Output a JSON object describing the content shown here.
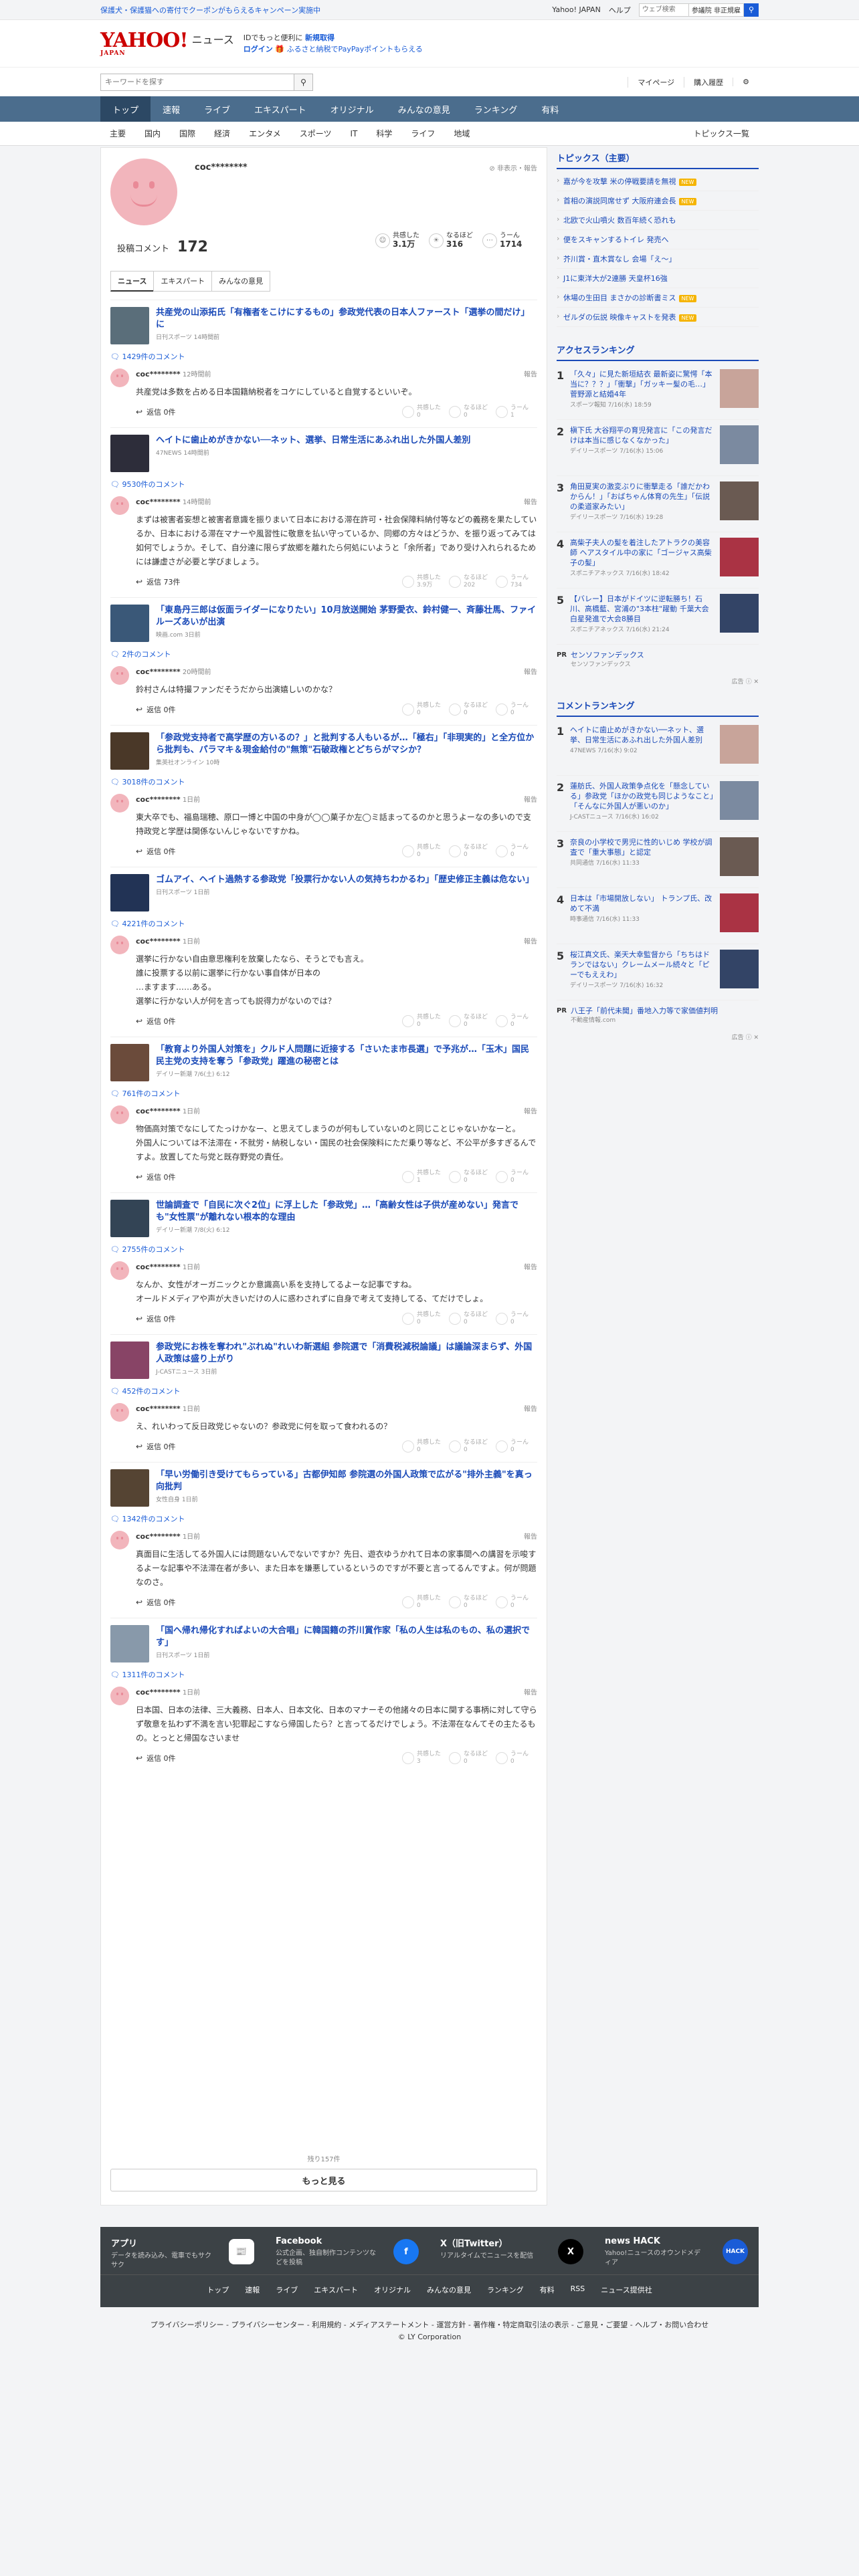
{
  "topbar": {
    "promo": "保護犬・保護猫への寄付でクーポンがもらえるキャンペーン実施中",
    "links": [
      "Yahoo! JAPAN",
      "ヘルプ"
    ],
    "search_placeholder": "ウェブ検索",
    "keyword": "参議院 非正規雇"
  },
  "header": {
    "logo": "YAHOO!",
    "logo_sub": "JAPAN",
    "section": "ニュース",
    "promo1_a": "IDでもっと便利に",
    "promo1_b": "新規取得",
    "promo2_a": "ログイン",
    "promo2_b": "ふるさと納税でPayPayポイントもらえる"
  },
  "search": {
    "placeholder": "キーワードを探す",
    "mypage": "マイページ",
    "history": "購入履歴"
  },
  "gnav": [
    "トップ",
    "速報",
    "ライブ",
    "エキスパート",
    "オリジナル",
    "みんなの意見",
    "ランキング",
    "有料"
  ],
  "subnav": [
    "主要",
    "国内",
    "国際",
    "経済",
    "エンタメ",
    "スポーツ",
    "IT",
    "科学",
    "ライフ",
    "地域"
  ],
  "subnav_right": "トピックス一覧",
  "profile": {
    "name": "coc********",
    "report": "非表示・報告",
    "stat_label": "投稿コメント",
    "stat_value": "172",
    "r1": "共感した",
    "r1v": "3.1万",
    "r2": "なるほど",
    "r2v": "316",
    "r3": "うーん",
    "r3v": "1714"
  },
  "tabs": [
    "ニュース",
    "エキスパート",
    "みんなの意見"
  ],
  "items": [
    {
      "title": "共産党の山添拓氏「有権者をこけにするもの」参政党代表の日本人ファースト「選挙の間だけ」に",
      "src": "日刊スポーツ 14時間前",
      "count": "1429件のコメント",
      "user": "coc********",
      "time": "12時間前",
      "report": "報告",
      "text": "共産党は多数を占める日本国籍納税者をコケにしていると自覚するといいぞ。",
      "reply": "返信 0件",
      "a": "共感した\n0",
      "b": "なるほど\n0",
      "c": "うーん\n1"
    },
    {
      "title": "ヘイトに歯止めがきかない──ネット、選挙、日常生活にあふれ出した外国人差別",
      "src": "47NEWS 14時間前",
      "count": "9530件のコメント",
      "user": "coc********",
      "time": "14時間前",
      "report": "報告",
      "text": "まずは被害者妄想と被害者意識を振りまいて日本における滞在許可・社会保障料納付等などの義務を果たしているか、日本における滞在マナーや風習性に敬意を払い守っているか、同郷の方々はどうか、を振り返ってみては如何でしょうか。そして、自分達に限らず故郷を離れたら何処にいようと「余所者」であり受け入れられるためには謙虚さが必要と学びましょう。",
      "reply": "返信 73件",
      "a": "共感した\n3.9万",
      "b": "なるほど\n202",
      "c": "うーん\n734"
    },
    {
      "title": "「東島丹三郎は仮面ライダーになりたい」10月放送開始 茅野愛衣、鈴村健一、斉藤壮馬、ファイルーズあいが出演",
      "src": "映画.com 3日前",
      "count": "2件のコメント",
      "user": "coc********",
      "time": "20時間前",
      "report": "報告",
      "text": "鈴村さんは特撮ファンだそうだから出演嬉しいのかな？",
      "reply": "返信 0件",
      "a": "共感した\n0",
      "b": "なるほど\n0",
      "c": "うーん\n0"
    },
    {
      "title": "「参政党支持者で高学歴の方いるの？」と批判する人もいるが…「極右」「非現実的」と全方位から批判も、パラマキ＆現金給付の\"無策\"石破政権とどちらがマシか？",
      "src": "集英社オンライン 10時",
      "count": "3018件のコメント",
      "user": "coc********",
      "time": "1日前",
      "report": "報告",
      "text": "東大卒でも、福島瑞穂、原口一博と中国の中身が◯◯菓子か左◯ミ話まってるのかと思うよーなの多いので支持政党と学歴は関係ないんじゃないですかね。",
      "reply": "返信 0件",
      "a": "共感した\n0",
      "b": "なるほど\n0",
      "c": "うーん\n0"
    },
    {
      "title": "ゴムアイ、ヘイト過熱する参政党「投票行かない人の気持ちわかるわ」「歴史修正主義は危ない」",
      "src": "日刊スポーツ 1日前",
      "count": "4221件のコメント",
      "user": "coc********",
      "time": "1日前",
      "report": "報告",
      "text": "選挙に行かない自由意思権利を放棄したなら、そうとでも言え。\n誰に投票する以前に選挙に行かない事自体が日本の\n…ますます……ある。\n選挙に行かない人が何を言っても説得力がないのでは？",
      "reply": "返信 0件",
      "a": "共感した\n0",
      "b": "なるほど\n0",
      "c": "うーん\n0"
    },
    {
      "title": "「教育より外国人対策を」クルド人問題に近接する「さいたま市長選」で予兆が…「玉木」国民民主党の支持を奪う「参政党」躍進の秘密とは",
      "src": "デイリー新潮 7/6(土) 6:12",
      "count": "761件のコメント",
      "user": "coc********",
      "time": "1日前",
      "report": "報告",
      "text": "物価高対策でなにしてたっけかなー、と思えてしまうのが何もしていないのと同じことじゃないかなーと。\n外国人については不法滞在・不就労・納税しない・国民の社会保険料にただ乗り等など、不公平が多すぎるんですよ。放置してた与党と既存野党の責任。",
      "reply": "返信 0件",
      "a": "共感した\n1",
      "b": "なるほど\n0",
      "c": "うーん\n0"
    },
    {
      "title": "世論調査で「自民に次ぐ2位」に浮上した「参政党」…「高齢女性は子供が産めない」発言でも\"女性票\"が離れない根本的な理由",
      "src": "デイリー新潮 7/8(火) 6:12",
      "count": "2755件のコメント",
      "user": "coc********",
      "time": "1日前",
      "report": "報告",
      "text": "なんか、女性がオーガニックとか意識高い系を支持してるよーな記事ですね。\nオールドメディアや声が大きいだけの人に惑わされずに自身で考えて支持してる、てだけでしょ。",
      "reply": "返信 0件",
      "a": "共感した\n0",
      "b": "なるほど\n0",
      "c": "うーん\n0"
    },
    {
      "title": "参政党にお株を奪われ\"ぶれぬ\"れいわ新選組 参院選で「消費税減税論議」は議論深まらず、外国人政策は盛り上がり",
      "src": "J-CASTニュース 3日前",
      "count": "452件のコメント",
      "user": "coc********",
      "time": "1日前",
      "report": "報告",
      "text": "え、れいわって反日政党じゃないの？参政党に何を取って食われるの？",
      "reply": "返信 0件",
      "a": "共感した\n0",
      "b": "なるほど\n0",
      "c": "うーん\n0"
    },
    {
      "title": "「早い労働引き受けてもらっている」古都伊知郎 参院選の外国人政策で広がる\"排外主義\"を真っ向批判",
      "src": "女性自身 1日前",
      "count": "1342件のコメント",
      "user": "coc********",
      "time": "1日前",
      "report": "報告",
      "text": "真面目に生活してる外国人には問題ないんでないですか？先日、遊衣ゆうかれて日本の家事間への講習を示唆するよーな記事や不法滞在者が多い、また日本を嫌悪しているというのですが不要と言ってるんですよ。何が問題なのさ。",
      "reply": "返信 0件",
      "a": "共感した\n0",
      "b": "なるほど\n0",
      "c": "うーん\n0"
    },
    {
      "title": "「国へ帰れ帰化すればよいの大合唱」に韓国籍の芥川賞作家「私の人生は私のもの、私の選択です」",
      "src": "日刊スポーツ 1日前",
      "count": "1311件のコメント",
      "user": "coc********",
      "time": "1日前",
      "report": "報告",
      "text": "日本国、日本の法律、三大義務、日本人、日本文化、日本のマナーその他諸々の日本に関する事柄に対して守らず敬意を払わず不満を言い犯罪起こすなら帰国したら？と言ってるだけでしょう。不法滞在なんてその主たるもの。とっとと帰国なさいませ",
      "reply": "返信 0件",
      "a": "共感した\n3",
      "b": "なるほど\n0",
      "c": "うーん\n0"
    }
  ],
  "more": {
    "remaining": "残り157件",
    "button": "もっと見る"
  },
  "side": {
    "topics_title": "トピックス（主要）",
    "topics": [
      "嘉が今を攻撃 米の停戦要請を無視",
      "首相の演説同席せず 大阪府連会長",
      "北欧で火山噴火 数百年続く恐れも",
      "便をスキャンするトイレ 発売へ",
      "芥川賞・直木賞なし 会場「え～」",
      "J1に東洋大が2連勝 天皇杯16強",
      "休場の生田目 まさかの診断書ミス",
      "ゼルダの伝説 映像キャストを発表"
    ],
    "new": "NEW",
    "access_title": "アクセスランキング",
    "access": [
      {
        "n": "1",
        "t": "「久々」に見た新垣結衣 最新姿に驚愕「本当に？？？」「衝撃」「ガッキー髪の毛…」菅野源と結婚4年",
        "s": "スポーツ報知 7/16(水) 18:59"
      },
      {
        "n": "2",
        "t": "槇下氏 大谷翔平の育児発言に「この発言だけは本当に感じなくなかった」",
        "s": "デイリースポーツ 7/16(水) 15:06"
      },
      {
        "n": "3",
        "t": "角田夏実の激変ぶりに衝撃走る「誰だかわからん！」「おばちゃん体育の先生」「伝説の柔道家みたい」",
        "s": "デイリースポーツ 7/16(水) 19:28"
      },
      {
        "n": "4",
        "t": "高柴子夫人の髪を着注したアトラクの美容師 ヘアスタイル中の家に「ゴージャス高柴子の髪」",
        "s": "スポニチアネックス 7/16(水) 18:42"
      },
      {
        "n": "5",
        "t": "【バレー】日本がドイツに逆転勝ち！石川、高橋藍、宮浦の\"3本柱\"躍動 千葉大会白星発進で大会8勝目",
        "s": "スポニチアネックス 7/16(水) 21:24"
      }
    ],
    "pr1": {
      "tag": "PR",
      "t": "センソファンデックス",
      "s": "センソファンデックス"
    },
    "ad": "広告",
    "comment_title": "コメントランキング",
    "comments": [
      {
        "n": "1",
        "t": "ヘイトに歯止めがきかない──ネット、選挙、日常生活にあふれ出した外国人差別",
        "s": "47NEWS 7/16(水) 9:02"
      },
      {
        "n": "2",
        "t": "蓮舫氏、外国人政策争点化を「懸念している」参政党「ほかの政党も同じようなこと」「そんなに外国人が悪いのか」",
        "s": "J-CASTニュース 7/16(水) 16:02"
      },
      {
        "n": "3",
        "t": "奈良の小学校で男児に性的いじめ 学校が調査で「重大事態」と認定",
        "s": "共同通信 7/16(水) 11:33"
      },
      {
        "n": "4",
        "t": "日本は「市場開放しない」 トランプ氏、改めて不満",
        "s": "時事通信 7/16(水) 11:33"
      },
      {
        "n": "5",
        "t": "桜江真文氏、楽天大幸監督から「ちちはドランではない」クレームメール続々と「ピーでもええわ」",
        "s": "デイリースポーツ 7/16(水) 16:32"
      }
    ],
    "pr2": {
      "tag": "PR",
      "t": "八王子「前代未聞」番地入力等で家価値判明",
      "s": "不動産情報.com"
    }
  },
  "footer": {
    "boxes": [
      {
        "t": "アプリ",
        "d": "データを読み込み、電車でもサクサク"
      },
      {
        "t": "Facebook",
        "d": "公式企画、独自制作コンテンツなどを投稿"
      },
      {
        "t": "X（旧Twitter）",
        "d": "リアルタイムでニュースを配信"
      },
      {
        "t": "news HACK",
        "d": "Yahoo!ニュースのオウンドメディア"
      }
    ],
    "links": [
      "トップ",
      "速報",
      "ライブ",
      "エキスパート",
      "オリジナル",
      "みんなの意見",
      "ランキング",
      "有料",
      "RSS",
      "ニュース提供社"
    ],
    "bottom": "プライバシーポリシー - プライバシーセンター - 利用規約 - メディアステートメント - 運営方針 - 著作権・特定商取引法の表示 - ご意見・ご要望 - ヘルプ・お問い合わせ",
    "copy": "© LY Corporation"
  },
  "colors": {
    "accent": "#1a5cd7",
    "nav": "#4b6d8d",
    "brand": "#cc0000",
    "avatar": "#f2b5bc"
  }
}
